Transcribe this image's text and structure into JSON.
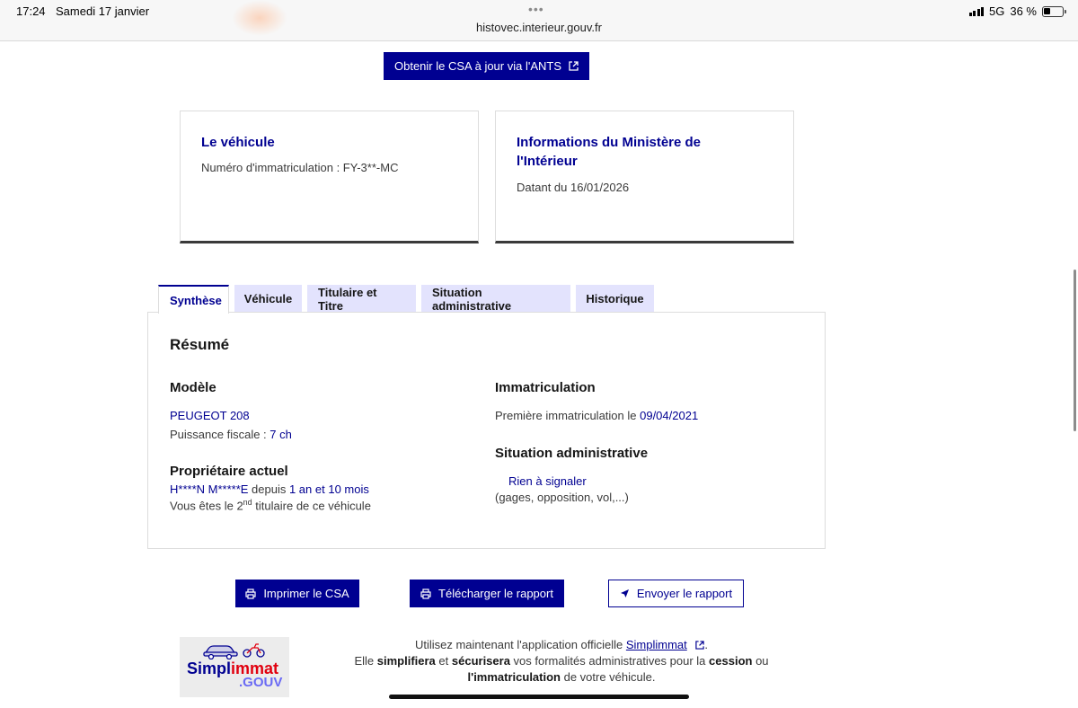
{
  "status_bar": {
    "time": "17:24",
    "date": "Samedi 17 janvier",
    "url": "histovec.interieur.gouv.fr",
    "network": "5G",
    "battery": "36 %",
    "dots": "•••"
  },
  "top_button": {
    "label": "Obtenir le CSA à jour via l'ANTS",
    "icon": "external-link-icon"
  },
  "vehicle_card": {
    "title": "Le véhicule",
    "text": "Numéro d'immatriculation : FY-3**-MC"
  },
  "ministry_card": {
    "title_line1": "Informations du Ministère de",
    "title_line2": "l'Intérieur",
    "text": "Datant du 16/01/2026"
  },
  "tabs": [
    {
      "label": "Synthèse",
      "active": true
    },
    {
      "label": "Véhicule",
      "active": false
    },
    {
      "label": "Titulaire et Titre",
      "active": false
    },
    {
      "label": "Situation administrative",
      "active": false
    },
    {
      "label": "Historique",
      "active": false
    }
  ],
  "summary": {
    "title": "Résumé",
    "model": {
      "heading": "Modèle",
      "name": "PEUGEOT 208",
      "power_label": "Puissance fiscale : ",
      "power_value": "7 ch"
    },
    "owner": {
      "heading": "Propriétaire actuel",
      "name": "H****N M*****E",
      "since_label": " depuis ",
      "since_value": "1 an et 10 mois",
      "rank_prefix": "Vous êtes le 2",
      "rank_sup": "nd",
      "rank_suffix": " titulaire de ce véhicule"
    },
    "registration": {
      "heading": "Immatriculation",
      "first_label": "Première immatriculation le ",
      "first_date": "09/04/2021"
    },
    "admin": {
      "heading": "Situation administrative",
      "status": "Rien à signaler",
      "details": "(gages, opposition, vol,...)"
    }
  },
  "actions": {
    "print": "Imprimer le CSA",
    "download": "Télécharger le rapport",
    "send": "Envoyer le rapport"
  },
  "footer": {
    "logo_word_1": "Simpl",
    "logo_word_2": "immat",
    "logo_gouv": ".GOUV",
    "line1_prefix": "Utilisez maintenant l'application officielle ",
    "app_link": "Simplimmat",
    "line1_suffix": ".",
    "line2_p1": "Elle ",
    "line2_b1": "simplifiera",
    "line2_p2": " et ",
    "line2_b2": "sécurisera",
    "line2_p3": " vos formalités administratives pour la ",
    "line2_b3": "cession",
    "line2_p4": " ou",
    "line3_b1": "l'immatriculation",
    "line3_p1": " de votre véhicule."
  },
  "colors": {
    "primary": "#000091",
    "tab_bg": "#e3e3fd",
    "accent_red": "#e1000f"
  }
}
